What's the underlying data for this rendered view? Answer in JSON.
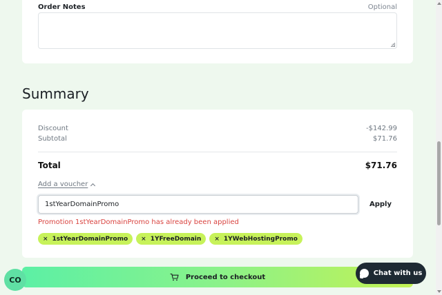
{
  "order_notes": {
    "label": "Order Notes",
    "optional_label": "Optional",
    "value": ""
  },
  "summary": {
    "heading": "Summary",
    "discount_label": "Discount",
    "discount_value": "-$142.99",
    "subtotal_label": "Subtotal",
    "subtotal_value": "$71.76",
    "total_label": "Total",
    "total_value": "$71.76"
  },
  "voucher": {
    "toggle_label": "Add a voucher",
    "input_value": "1stYearDomainPromo",
    "apply_label": "Apply",
    "error_message": "Promotion 1stYearDomainPromo has already been applied",
    "applied": [
      {
        "remove": "×",
        "code": "1stYearDomainPromo"
      },
      {
        "remove": "×",
        "code": "1YFreeDomain"
      },
      {
        "remove": "×",
        "code": "1YWebHostingPromo"
      }
    ]
  },
  "checkout": {
    "label": "Proceed to checkout",
    "icon": "cart-icon"
  },
  "chat": {
    "label": "Chat with us",
    "icon": "chat-bubble-icon"
  },
  "badge": {
    "label": "CO"
  },
  "colors": {
    "page_bg": "#eef8ee",
    "chip_bg": "#c7f25a",
    "error": "#d9433f",
    "chat_bg": "#1e2a33",
    "checkout_gradient_start": "#5cf0a5",
    "checkout_gradient_end": "#c3f254"
  }
}
